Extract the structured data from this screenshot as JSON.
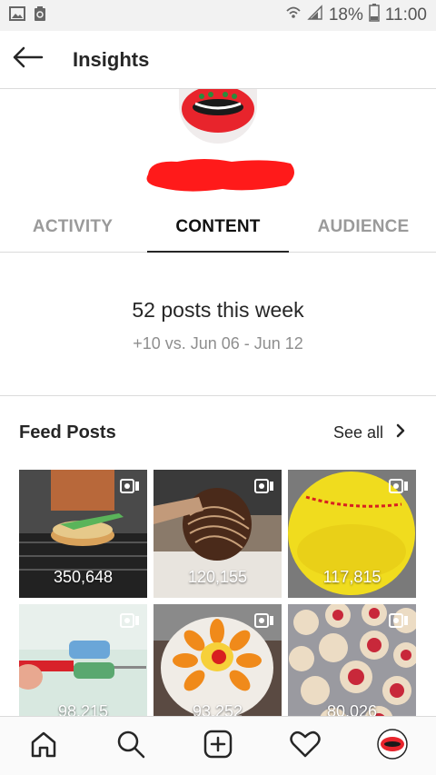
{
  "status_bar": {
    "battery": "18%",
    "time": "11:00"
  },
  "header": {
    "title": "Insights"
  },
  "tabs": [
    {
      "label": "ACTIVITY",
      "active": false
    },
    {
      "label": "CONTENT",
      "active": true
    },
    {
      "label": "AUDIENCE",
      "active": false
    }
  ],
  "summary": {
    "main": "52 posts this week",
    "sub": "+10 vs. Jun 06 - Jun 12"
  },
  "feed": {
    "title": "Feed Posts",
    "see_all": "See all",
    "posts": [
      {
        "count": "350,648",
        "type": "video"
      },
      {
        "count": "120,155",
        "type": "video"
      },
      {
        "count": "117,815",
        "type": "video"
      },
      {
        "count": "98,215",
        "type": "video"
      },
      {
        "count": "93,252",
        "type": "video"
      },
      {
        "count": "80,026",
        "type": "video"
      }
    ]
  },
  "colors": {
    "accent": "#262626",
    "muted": "#8e8e8e",
    "redaction": "#ff1a1a"
  }
}
